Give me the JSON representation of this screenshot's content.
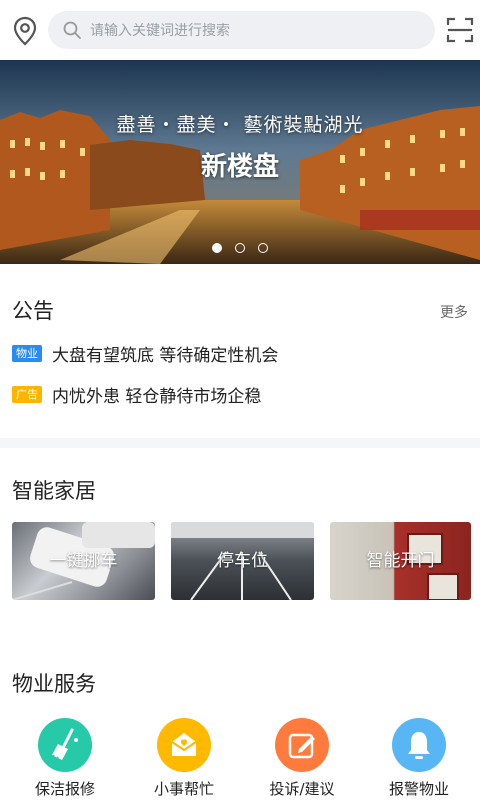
{
  "search": {
    "placeholder": "请输入关键词进行搜索"
  },
  "banner": {
    "title": "盡善・盡美・ 藝術裝點湖光",
    "subtitle": "新楼盘",
    "slides": 3,
    "active_slide": 1
  },
  "announcements": {
    "title": "公告",
    "more_label": "更多",
    "items": [
      {
        "tag": "物业",
        "tag_color": "#2a8cf0",
        "text": "大盘有望筑底 等待确定性机会"
      },
      {
        "tag": "广告",
        "tag_color": "#ffb400",
        "text": "内忧外患 轻仓静待市场企稳"
      }
    ]
  },
  "smart_home": {
    "title": "智能家居",
    "cards": [
      {
        "label": "一键挪车"
      },
      {
        "label": "停车位"
      },
      {
        "label": "智能开门"
      }
    ]
  },
  "property_services": {
    "title": "物业服务",
    "items": [
      {
        "label": "保洁报修",
        "icon": "broom-icon",
        "color": "#26c9a8"
      },
      {
        "label": "小事帮忙",
        "icon": "envelope-icon",
        "color": "#ffb900"
      },
      {
        "label": "投诉/建议",
        "icon": "edit-icon",
        "color": "#ff7a3d"
      },
      {
        "label": "报警物业",
        "icon": "bell-icon",
        "color": "#58b6f5"
      }
    ]
  }
}
